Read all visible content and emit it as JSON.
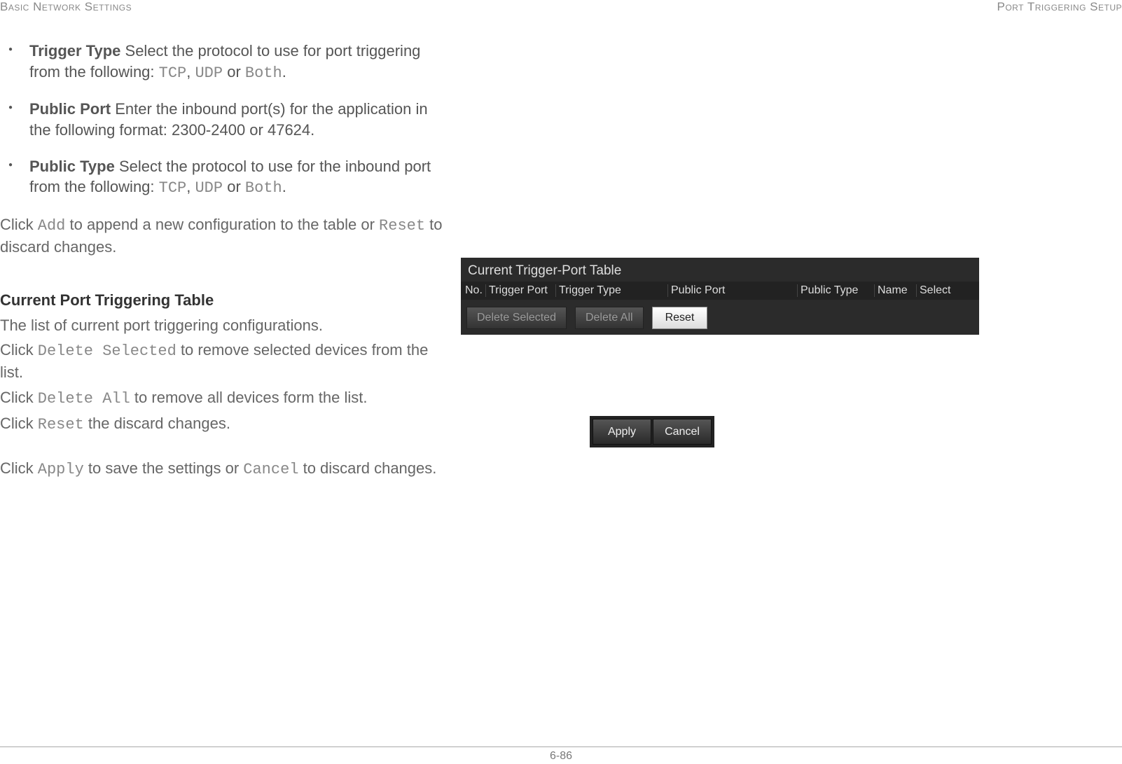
{
  "header": {
    "left": "Basic Network Settings",
    "right": "Port Triggering Setup"
  },
  "bullets": {
    "trigger_type": {
      "label": "Trigger Type",
      "text1": "  Select the protocol to use for port triggering from the following: ",
      "code1": "TCP",
      "sep1": ", ",
      "code2": "UDP",
      "sep2": " or ",
      "code3": "Both",
      "end": "."
    },
    "public_port": {
      "label": "Public Port",
      "text": "  Enter the inbound port(s) for the application in the following format: 2300-2400 or 47624."
    },
    "public_type": {
      "label": "Public Type",
      "text1": "  Select the protocol to use for the inbound port from the following: ",
      "code1": "TCP",
      "sep1": ", ",
      "code2": "UDP",
      "sep2": " or ",
      "code3": "Both",
      "end": "."
    }
  },
  "paras": {
    "add_reset": {
      "pre1": "Click ",
      "code1": "Add",
      "mid1": " to append a new configuration to the table or ",
      "code2": "Reset",
      "end": " to discard changes."
    },
    "section_heading": "Current Port Triggering Table",
    "list_desc": "The list of current port triggering configurations.",
    "delete_selected": {
      "pre": "Click ",
      "code": "Delete Selected",
      "end": " to remove selected devices from the list."
    },
    "delete_all": {
      "pre": "Click ",
      "code": "Delete All",
      "end": " to remove all devices form the list."
    },
    "reset_line": {
      "pre": "Click ",
      "code": "Reset",
      "end": " the discard changes."
    },
    "apply_cancel": {
      "pre": "Click ",
      "code1": "Apply",
      "mid": " to save the settings or ",
      "code2": "Cancel",
      "end": " to discard changes."
    }
  },
  "ui_table": {
    "title": "Current Trigger-Port Table",
    "cols": {
      "no": "No.",
      "trigger_port": "Trigger Port",
      "trigger_type": "Trigger Type",
      "public_port": "Public Port",
      "public_type": "Public Type",
      "name": "Name",
      "select": "Select"
    },
    "buttons": {
      "delete_selected": "Delete Selected",
      "delete_all": "Delete All",
      "reset": "Reset"
    }
  },
  "ui_actions": {
    "apply": "Apply",
    "cancel": "Cancel"
  },
  "footer": "6-86"
}
